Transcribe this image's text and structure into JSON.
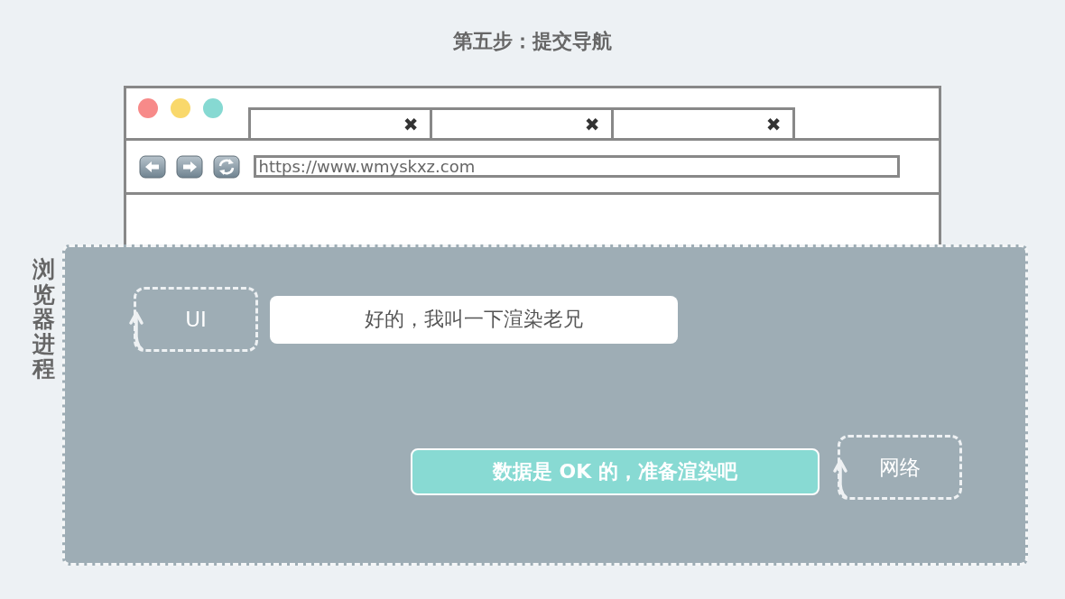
{
  "title": "第五步：提交导航",
  "browser": {
    "traffic_lights": [
      {
        "color": "#f78a89"
      },
      {
        "color": "#f9d86b"
      },
      {
        "color": "#86d9d2"
      }
    ],
    "tabs": [
      {
        "close": "✖"
      },
      {
        "close": "✖"
      },
      {
        "close": "✖"
      }
    ],
    "address": "https://www.wmyskxz.com"
  },
  "process": {
    "label": "浏览器进程",
    "ui": {
      "label": "UI",
      "message": "好的，我叫一下渲染老兄"
    },
    "network": {
      "label": "网络",
      "message": "数据是 OK 的，准备渲染吧"
    }
  }
}
